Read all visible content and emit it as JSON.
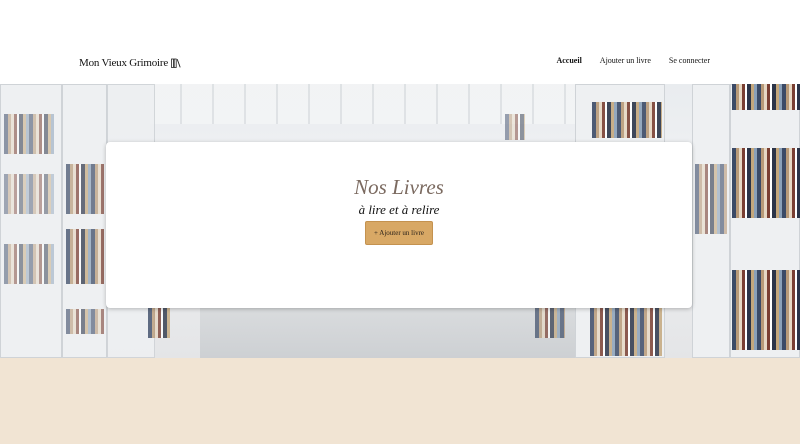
{
  "header": {
    "logo_text": "Mon Vieux Grimoire",
    "nav": [
      {
        "label": "Accueil",
        "active": true
      },
      {
        "label": "Ajouter un livre",
        "active": false
      },
      {
        "label": "Se connecter",
        "active": false
      }
    ]
  },
  "hero": {
    "title": "Nos Livres",
    "subtitle": "à lire et à relire",
    "add_button_label": "+ Ajouter un livre"
  },
  "colors": {
    "accent": "#d8a865",
    "title": "#7b6a60",
    "bottom_band": "#f1e4d3"
  }
}
